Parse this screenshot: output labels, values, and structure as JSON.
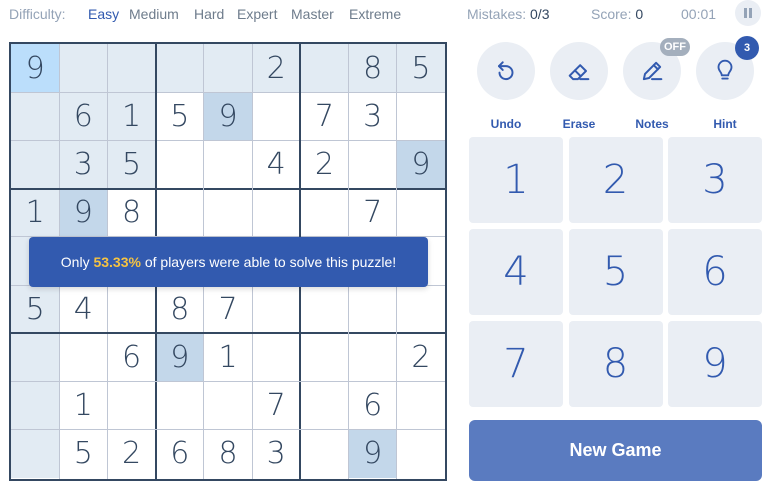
{
  "top": {
    "difficulty_label": "Difficulty:",
    "difficulties": [
      "Easy",
      "Medium",
      "Hard",
      "Expert",
      "Master",
      "Extreme"
    ],
    "active_difficulty": "Easy",
    "mistakes_label": "Mistakes:",
    "mistakes_value": "0/3",
    "score_label": "Score:",
    "score_value": "0",
    "timer": "00:01"
  },
  "board": {
    "grid": [
      [
        "9",
        "",
        "",
        "",
        "",
        "2",
        "",
        "8",
        "5"
      ],
      [
        "",
        "6",
        "1",
        "5",
        "9",
        "",
        "7",
        "3",
        ""
      ],
      [
        "",
        "3",
        "5",
        "",
        "",
        "4",
        "2",
        "",
        "9"
      ],
      [
        "1",
        "9",
        "8",
        "",
        "",
        "",
        "",
        "7",
        ""
      ],
      [
        "",
        "",
        "",
        "",
        "",
        "",
        "",
        "",
        ""
      ],
      [
        "5",
        "4",
        "",
        "8",
        "7",
        "",
        "",
        "",
        ""
      ],
      [
        "",
        "",
        "6",
        "9",
        "1",
        "",
        "",
        "",
        "2"
      ],
      [
        "",
        "1",
        "",
        "",
        "",
        "7",
        "",
        "6",
        ""
      ],
      [
        "",
        "5",
        "2",
        "6",
        "8",
        "3",
        "",
        "9",
        ""
      ]
    ],
    "selected": [
      0,
      0
    ],
    "highlight_color": "#c3d7ea"
  },
  "toast": {
    "prefix": "Only ",
    "percent": "53.33%",
    "suffix": " of players were able to solve this puzzle!"
  },
  "controls": {
    "undo": "Undo",
    "erase": "Erase",
    "notes": "Notes",
    "notes_badge": "OFF",
    "hint": "Hint",
    "hint_badge": "3"
  },
  "numpad": [
    "1",
    "2",
    "3",
    "4",
    "5",
    "6",
    "7",
    "8",
    "9"
  ],
  "new_game": "New Game",
  "colors": {
    "accent": "#325aaf",
    "text": "#344861",
    "cell_peer": "#e2ebf3",
    "cell_selected": "#bbdefb",
    "button_bg": "#eaeef4",
    "new_game_bg": "#5a7bc0",
    "toast_highlight": "#f5c342"
  }
}
